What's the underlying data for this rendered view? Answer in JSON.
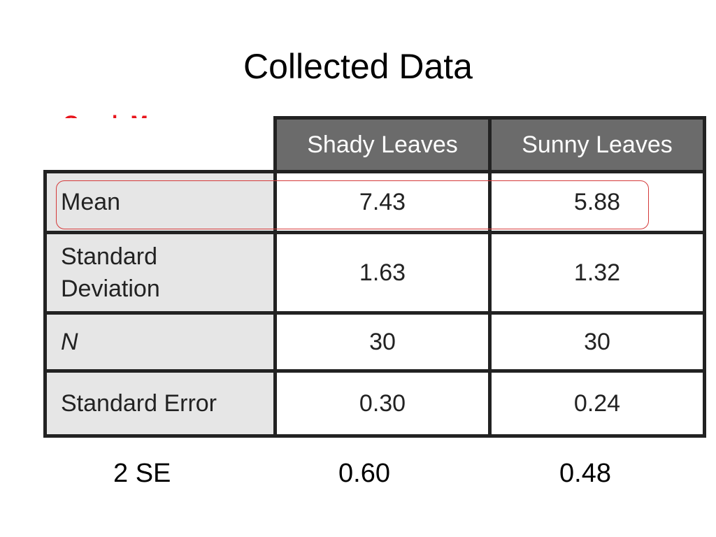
{
  "title": "Collected Data",
  "annotation": {
    "label": "Graph Mean",
    "color": "#e8141b"
  },
  "table": {
    "headers": [
      "",
      "Shady Leaves",
      "Sunny Leaves"
    ],
    "rows": [
      {
        "label": "Mean",
        "values": [
          "7.43",
          "5.88"
        ]
      },
      {
        "label": "Standard Deviation",
        "values": [
          "1.63",
          "1.32"
        ]
      },
      {
        "label": "N",
        "values": [
          "30",
          "30"
        ]
      },
      {
        "label": "Standard Error",
        "values": [
          "0.30",
          "0.24"
        ]
      }
    ]
  },
  "two_se": {
    "label": "2 SE",
    "values": [
      "0.60",
      "0.48"
    ]
  }
}
